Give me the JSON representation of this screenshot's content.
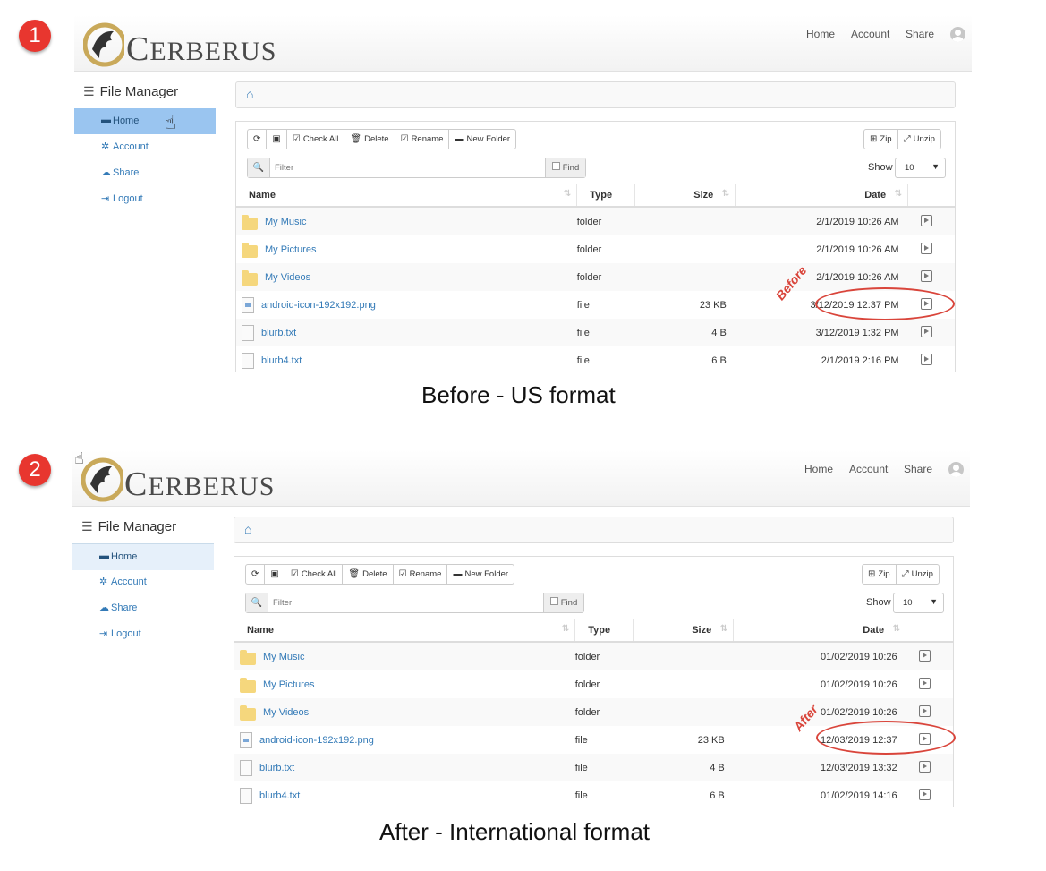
{
  "badges": [
    "1",
    "2"
  ],
  "captions": {
    "before": "Before - US format",
    "after": "After - International format"
  },
  "annotations": {
    "before": "Before",
    "after": "After"
  },
  "app": {
    "logo_initial": "C",
    "logo_rest": "ERBERUS",
    "nav": {
      "home": "Home",
      "account": "Account",
      "share": "Share"
    },
    "file_manager_title": "File Manager",
    "sidebar": [
      {
        "label": "Home",
        "icon": "folder-icon"
      },
      {
        "label": "Account",
        "icon": "gear-icon"
      },
      {
        "label": "Share",
        "icon": "cloud-icon"
      },
      {
        "label": "Logout",
        "icon": "logout-icon"
      }
    ],
    "toolbar": {
      "check_all": "Check All",
      "delete": "Delete",
      "rename": "Rename",
      "new_folder": "New Folder",
      "zip": "Zip",
      "unzip": "Unzip"
    },
    "filter_placeholder": "Filter",
    "find_label": "Find",
    "show_label": "Show",
    "show_value": "10",
    "columns": {
      "name": "Name",
      "type": "Type",
      "size": "Size",
      "date": "Date"
    }
  },
  "panels": [
    {
      "rows": [
        {
          "name": "My Music",
          "type": "folder",
          "size": "",
          "date": "2/1/2019 10:26 AM",
          "icon": "folder"
        },
        {
          "name": "My Pictures",
          "type": "folder",
          "size": "",
          "date": "2/1/2019 10:26 AM",
          "icon": "folder"
        },
        {
          "name": "My Videos",
          "type": "folder",
          "size": "",
          "date": "2/1/2019 10:26 AM",
          "icon": "folder"
        },
        {
          "name": "android-icon-192x192.png",
          "type": "file",
          "size": "23 KB",
          "date": "3/12/2019 12:37 PM",
          "icon": "image"
        },
        {
          "name": "blurb.txt",
          "type": "file",
          "size": "4 B",
          "date": "3/12/2019 1:32 PM",
          "icon": "file"
        },
        {
          "name": "blurb4.txt",
          "type": "file",
          "size": "6 B",
          "date": "2/1/2019 2:16 PM",
          "icon": "file"
        }
      ]
    },
    {
      "rows": [
        {
          "name": "My Music",
          "type": "folder",
          "size": "",
          "date": "01/02/2019 10:26",
          "icon": "folder"
        },
        {
          "name": "My Pictures",
          "type": "folder",
          "size": "",
          "date": "01/02/2019 10:26",
          "icon": "folder"
        },
        {
          "name": "My Videos",
          "type": "folder",
          "size": "",
          "date": "01/02/2019 10:26",
          "icon": "folder"
        },
        {
          "name": "android-icon-192x192.png",
          "type": "file",
          "size": "23 KB",
          "date": "12/03/2019 12:37",
          "icon": "image"
        },
        {
          "name": "blurb.txt",
          "type": "file",
          "size": "4 B",
          "date": "12/03/2019 13:32",
          "icon": "file"
        },
        {
          "name": "blurb4.txt",
          "type": "file",
          "size": "6 B",
          "date": "01/02/2019 14:16",
          "icon": "file"
        }
      ]
    }
  ]
}
